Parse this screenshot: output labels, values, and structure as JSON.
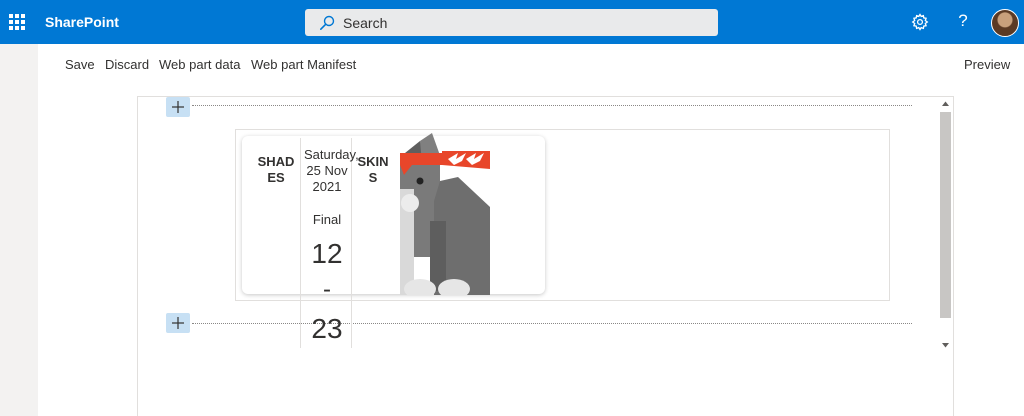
{
  "header": {
    "app_name": "SharePoint",
    "search_placeholder": "Search",
    "help_glyph": "?",
    "icons": [
      "waffle-icon",
      "search-icon",
      "gear-icon",
      "help-icon",
      "avatar"
    ],
    "brand_color": "#0078d4"
  },
  "commands": {
    "save": "Save",
    "discard": "Discard",
    "web_part_data": "Web part data",
    "web_part_manifest": "Web part Manifest",
    "preview": "Preview"
  },
  "match_card": {
    "home_team": "SHADES",
    "away_team": "SKINS",
    "date": "Saturday, 25 Nov 2021",
    "status": "Final",
    "home_score": "12",
    "score_separator": "-",
    "away_score": "23",
    "mascot_icon": "ninja-cat-icon"
  },
  "colors": {
    "accent": "#0078d4",
    "add_button": "#c7e0f4",
    "mascot_grey": "#737373",
    "mascot_band": "#e8462a"
  }
}
